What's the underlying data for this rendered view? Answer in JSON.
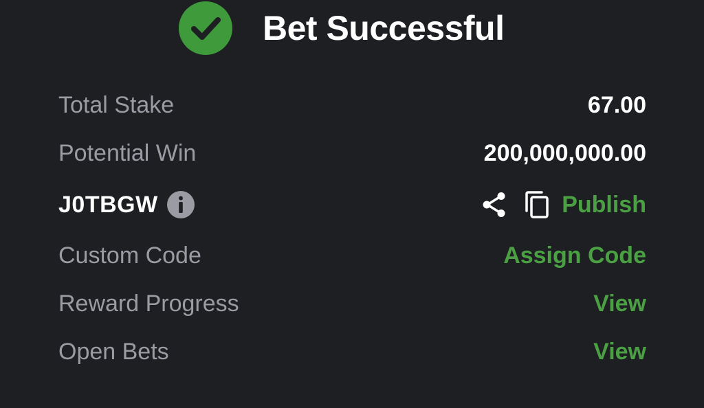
{
  "header": {
    "title": "Bet Successful",
    "icon": "check-circle-icon",
    "icon_color": "#3f9a3c"
  },
  "summary": {
    "total_stake": {
      "label": "Total Stake",
      "value": "67.00"
    },
    "potential_win": {
      "label": "Potential Win",
      "value": "200,000,000.00"
    }
  },
  "booking": {
    "code": "J0TBGW",
    "info_icon": "info-icon",
    "share_icon": "share-icon",
    "copy_icon": "copy-icon",
    "publish_label": "Publish"
  },
  "custom_code": {
    "label": "Custom Code",
    "action": "Assign Code"
  },
  "reward_progress": {
    "label": "Reward Progress",
    "action": "View"
  },
  "open_bets": {
    "label": "Open Bets",
    "action": "View"
  },
  "colors": {
    "background": "#1e1f23",
    "accent": "#4aa043",
    "label": "#9a9ba3",
    "value": "#ffffff"
  }
}
